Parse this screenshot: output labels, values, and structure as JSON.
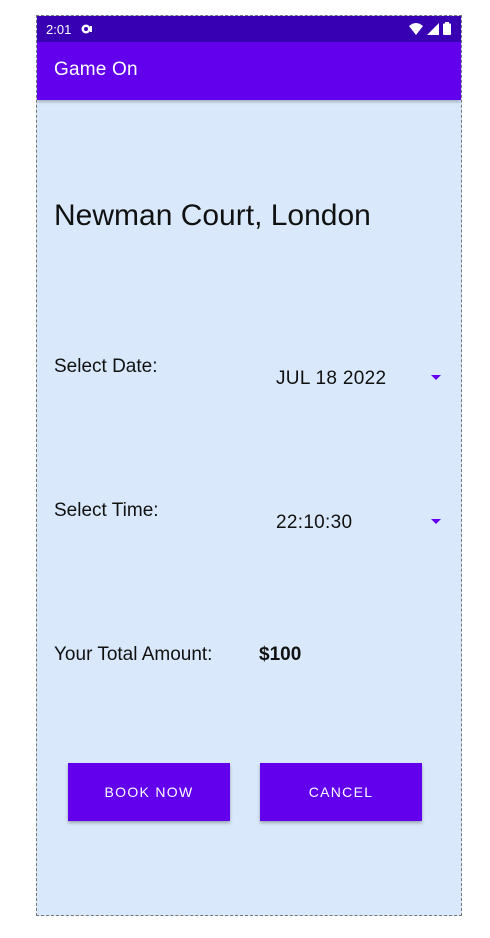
{
  "status_bar": {
    "time": "2:01"
  },
  "app_bar": {
    "title": "Game On"
  },
  "venue": {
    "title": "Newman Court, London"
  },
  "date": {
    "label": "Select Date:",
    "value": "JUL 18 2022"
  },
  "time": {
    "label": "Select Time:",
    "value": "22:10:30"
  },
  "total": {
    "label": "Your Total Amount:",
    "value": "$100"
  },
  "buttons": {
    "book_now": "BOOK NOW",
    "cancel": "CANCEL"
  },
  "colors": {
    "status_bar": "#3700b3",
    "primary": "#6200ee",
    "background": "#d9e9fb"
  }
}
